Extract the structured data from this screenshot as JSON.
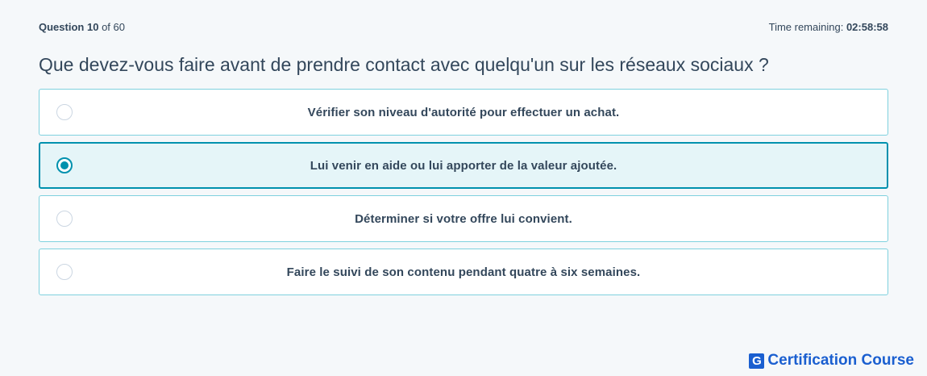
{
  "header": {
    "question_label": "Question",
    "question_number": "10",
    "question_of": "of 60",
    "time_label": "Time remaining:",
    "time_value": "02:58:58"
  },
  "question": {
    "text": "Que devez-vous faire avant de prendre contact avec quelqu'un sur les réseaux sociaux ?"
  },
  "options": [
    {
      "label": "Vérifier son niveau d'autorité pour effectuer un achat.",
      "selected": false
    },
    {
      "label": "Lui venir en aide ou lui apporter de la valeur ajoutée.",
      "selected": true
    },
    {
      "label": "Déterminer si votre offre lui convient.",
      "selected": false
    },
    {
      "label": "Faire le suivi de son contenu pendant quatre à six semaines.",
      "selected": false
    }
  ],
  "brand": {
    "logo_letter": "G",
    "name": "Certification Course",
    "color": "#1a5fd0"
  },
  "colors": {
    "accent": "#0091ae",
    "option_border": "#7fd1de",
    "selected_bg": "#e5f5f8",
    "text": "#33475b"
  }
}
